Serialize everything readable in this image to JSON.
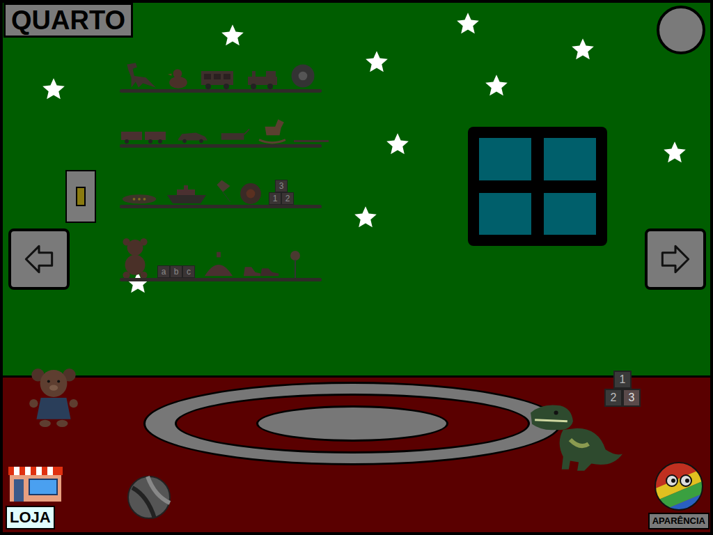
{
  "room": {
    "title": "QUARTO"
  },
  "shelf_blocks": {
    "numbers": [
      "3",
      "1",
      "2"
    ],
    "letters": [
      "a",
      "b",
      "c"
    ]
  },
  "floor_blocks": [
    "1",
    "2",
    "3"
  ],
  "shop": {
    "label": "LOJA"
  },
  "appearance": {
    "label": "APARÊNCIA"
  }
}
